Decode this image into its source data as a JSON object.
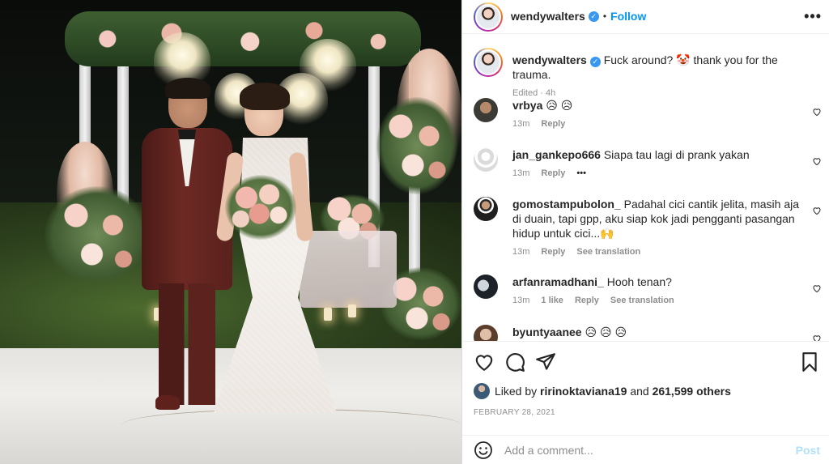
{
  "post": {
    "username": "wendywalters",
    "verified_mark": "✓",
    "separator": "•",
    "follow_label": "Follow",
    "more_label": "•••"
  },
  "caption": {
    "username": "wendywalters",
    "text": "Fuck around? 🤡 thank you for the trauma.",
    "edited_label": "Edited · 4h"
  },
  "comments": [
    {
      "username": "vrbya",
      "text": "😥 😥",
      "time": "13m",
      "reply_label": "Reply",
      "extra": ""
    },
    {
      "username": "jan_gankepo666",
      "text": "Siapa tau lagi di prank yakan",
      "time": "13m",
      "reply_label": "Reply",
      "extra": "•••"
    },
    {
      "username": "gomostampubolon_",
      "text": "Padahal cici cantik jelita, masih aja di duain, tapi gpp, aku siap kok jadi pengganti pasangan hidup untuk cici...🙌",
      "time": "13m",
      "reply_label": "Reply",
      "extra": "See translation"
    },
    {
      "username": "arfanramadhani_",
      "text": "Hooh tenan?",
      "time": "13m",
      "likes": "1 like",
      "reply_label": "Reply",
      "extra": "See translation"
    },
    {
      "username": "byuntyaanee",
      "text": "😥 😥 😥"
    }
  ],
  "icons": {
    "like": "heart-icon",
    "comment": "comment-icon",
    "share": "share-icon",
    "save": "bookmark-icon",
    "emoji": "emoji-icon"
  },
  "likes": {
    "prefix": "Liked by",
    "user": "ririnoktaviana19",
    "joiner": "and",
    "others": "261,599 others"
  },
  "date": "FEBRUARY 28, 2021",
  "add_comment": {
    "placeholder": "Add a comment...",
    "post_label": "Post"
  },
  "colors": {
    "accent": "#0095f6",
    "verified": "#3897f0",
    "post_disabled": "#b2dffc",
    "muted": "#8e8e8e"
  }
}
